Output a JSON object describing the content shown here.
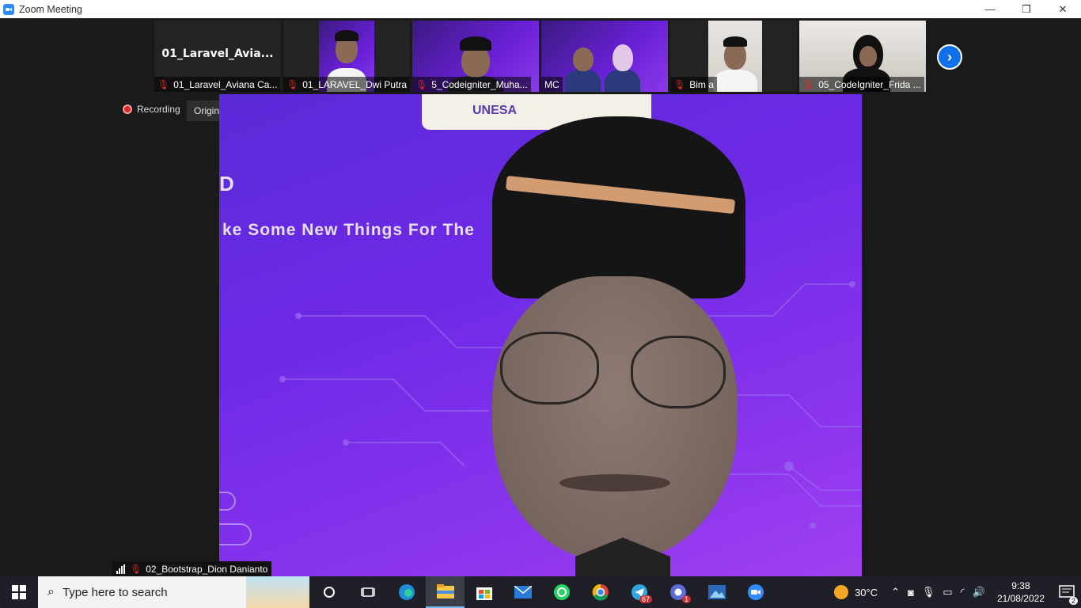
{
  "window": {
    "title": "Zoom Meeting",
    "minimize": "—",
    "restore": "❐",
    "close": "✕"
  },
  "thumbnails": [
    {
      "name_only": "01_Laravel_Avia...",
      "label": "01_Laravel_Aviana Ca...",
      "muted": true
    },
    {
      "label": "01_LARAVEL_Dwi Putra",
      "muted": true
    },
    {
      "label": "5_Codeigniter_Muha...",
      "muted": true
    },
    {
      "label": "MC",
      "muted": false
    },
    {
      "label": "Bim a",
      "muted": true
    },
    {
      "label": "05_CodeIgniter_Frida ...",
      "muted": true
    }
  ],
  "next_arrow": "›",
  "recording": {
    "label": "Recording"
  },
  "original_sound": {
    "label": "Original Sound: Off"
  },
  "main_video": {
    "banner_text": "UNESA",
    "slogan": "ke Some New Things For The",
    "wp": "D"
  },
  "speaker": {
    "name": "02_Bootstrap_Dion Danianto"
  },
  "taskbar": {
    "search_placeholder": "Type here to search",
    "telegram_badge": "67",
    "chrome2_badge": "1",
    "temperature": "30°C",
    "time": "9:38",
    "date": "21/08/2022",
    "notifications": "2"
  },
  "colors": {
    "zoom_blue": "#2d8cff",
    "mute_red": "#e02828",
    "taskbar": "#1f2027"
  }
}
